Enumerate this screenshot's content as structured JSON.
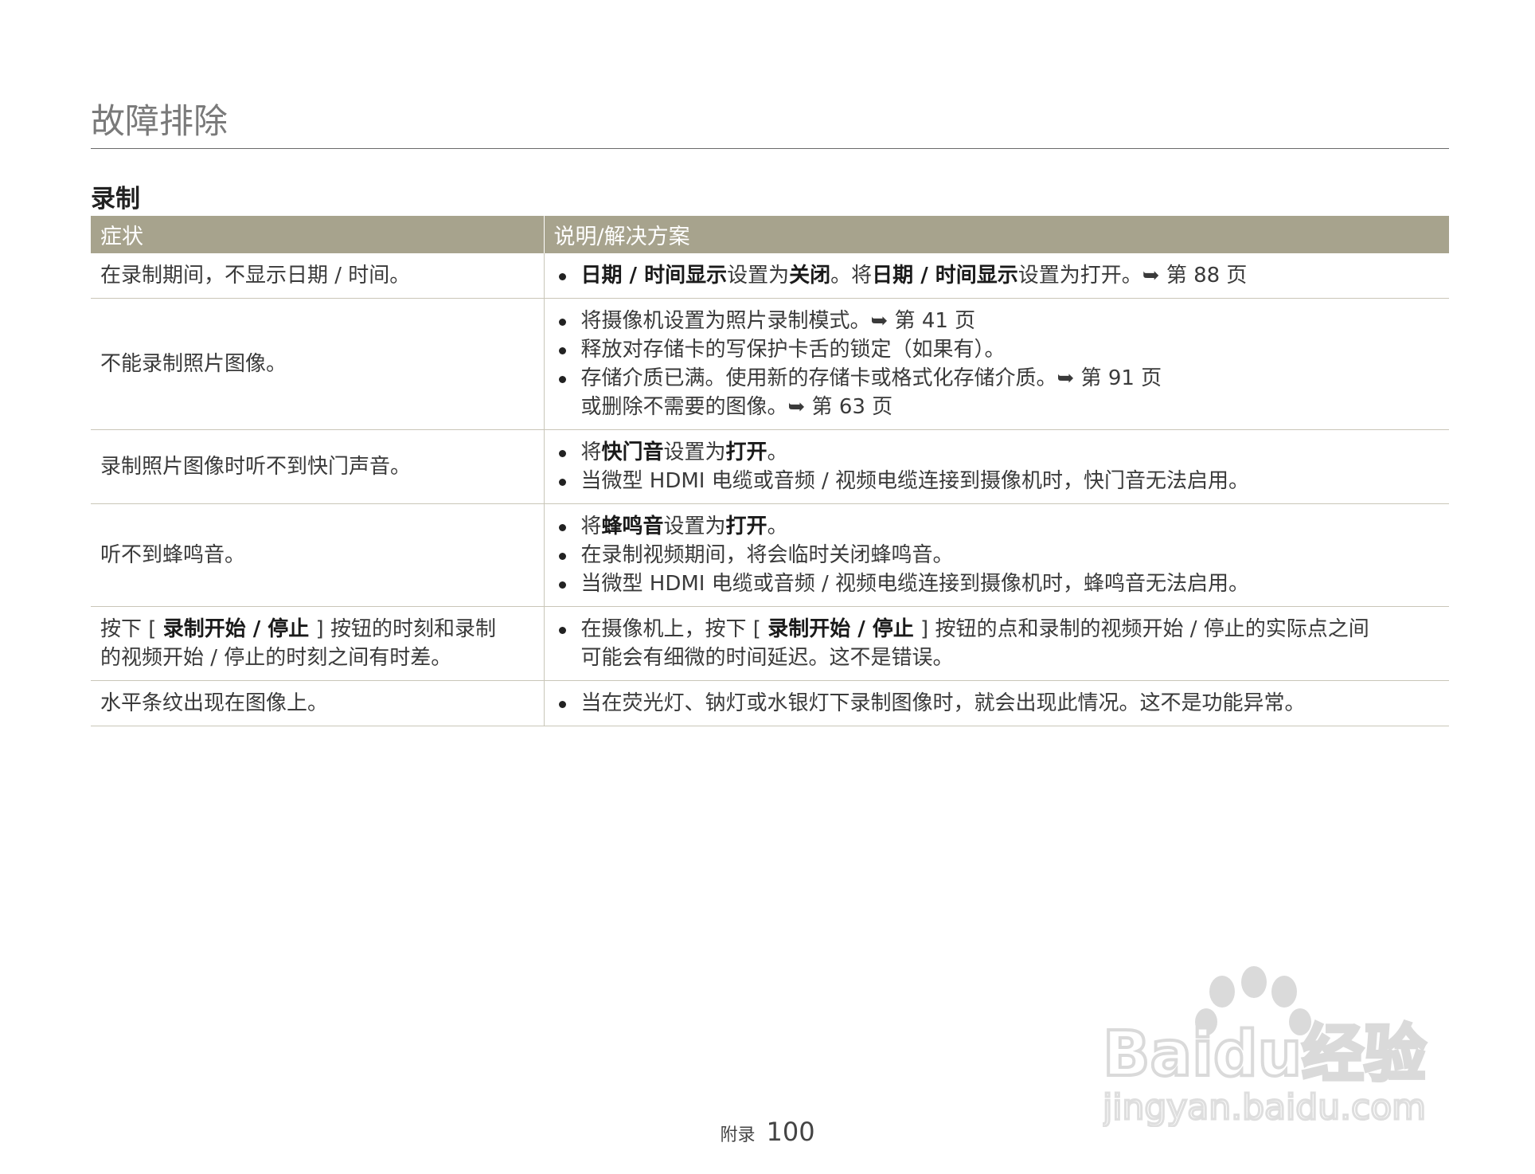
{
  "page": {
    "title": "故障排除",
    "section": "录制"
  },
  "table": {
    "headers": [
      "症状",
      "说明/解决方案"
    ],
    "rows": [
      {
        "symptom": "在录制期间，不显示日期 / 时间。",
        "solutions": [
          [
            {
              "t": "日期 / 时间显示",
              "b": true
            },
            {
              "t": "设置为"
            },
            {
              "t": "关闭",
              "b": true
            },
            {
              "t": "。将"
            },
            {
              "t": "日期 / 时间显示",
              "b": true
            },
            {
              "t": "设置为打开。➥ 第 88 页"
            }
          ]
        ]
      },
      {
        "symptom": "不能录制照片图像。",
        "solutions": [
          [
            {
              "t": "将摄像机设置为照片录制模式。➥ 第 41 页"
            }
          ],
          [
            {
              "t": "释放对存储卡的写保护卡舌的锁定（如果有）。"
            }
          ],
          [
            {
              "t": "存储介质已满。使用新的存储卡或格式化存储介质。➥ 第 91 页"
            },
            {
              "br": true
            },
            {
              "t": "或删除不需要的图像。➥ 第 63 页"
            }
          ]
        ]
      },
      {
        "symptom": "录制照片图像时听不到快门声音。",
        "solutions": [
          [
            {
              "t": "将"
            },
            {
              "t": "快门音",
              "b": true
            },
            {
              "t": "设置为"
            },
            {
              "t": "打开",
              "b": true
            },
            {
              "t": "。"
            }
          ],
          [
            {
              "t": "当微型 HDMI 电缆或音频 / 视频电缆连接到摄像机时，快门音无法启用。"
            }
          ]
        ]
      },
      {
        "symptom": "听不到蜂鸣音。",
        "solutions": [
          [
            {
              "t": "将"
            },
            {
              "t": "蜂鸣音",
              "b": true
            },
            {
              "t": "设置为"
            },
            {
              "t": "打开",
              "b": true
            },
            {
              "t": "。"
            }
          ],
          [
            {
              "t": "在录制视频期间，将会临时关闭蜂鸣音。"
            }
          ],
          [
            {
              "t": "当微型 HDMI 电缆或音频 / 视频电缆连接到摄像机时，蜂鸣音无法启用。"
            }
          ]
        ]
      },
      {
        "symptom_parts": [
          {
            "t": "按下 [ "
          },
          {
            "t": "录制开始 / 停止",
            "b": true
          },
          {
            "t": " ] 按钮的时刻和录制"
          },
          {
            "br": true
          },
          {
            "t": "的视频开始 / 停止的时刻之间有时差。"
          }
        ],
        "solutions": [
          [
            {
              "t": "在摄像机上，按下 [ "
            },
            {
              "t": "录制开始 / 停止",
              "b": true
            },
            {
              "t": " ] 按钮的点和录制的视频开始 / 停止的实际点之间"
            },
            {
              "br": true
            },
            {
              "t": "可能会有细微的时间延迟。这不是错误。"
            }
          ]
        ]
      },
      {
        "symptom": "水平条纹出现在图像上。",
        "solutions": [
          [
            {
              "t": "当在荧光灯、钠灯或水银灯下录制图像时，就会出现此情况。这不是功能异常。"
            }
          ]
        ]
      }
    ]
  },
  "footer": {
    "label": "附录",
    "page_number": "100"
  },
  "watermark": {
    "brand": "Baidu经验",
    "url": "jingyan.baidu.com"
  }
}
